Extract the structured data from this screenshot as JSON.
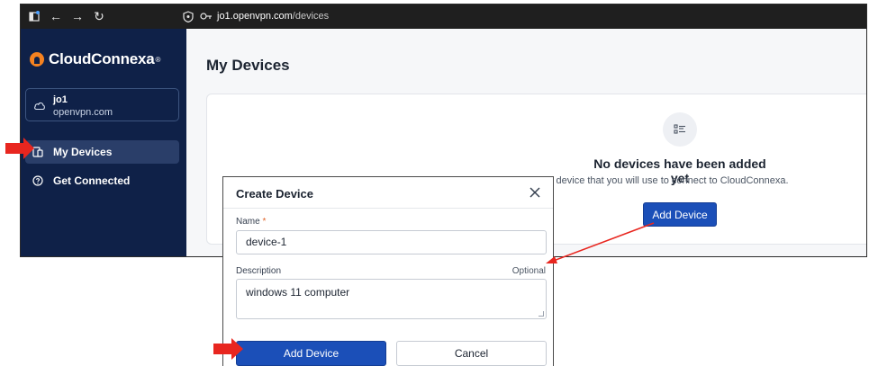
{
  "browser": {
    "url_domain": "jo1.openvpn.com",
    "url_path": "/devices",
    "icons": [
      "tab-icon",
      "back-arrow-icon",
      "forward-arrow-icon",
      "reload-icon",
      "shield-icon",
      "key-icon"
    ]
  },
  "sidebar": {
    "brand": "CloudConnexa",
    "brand_mark": "®",
    "org": {
      "name": "jo1",
      "domain": "openvpn.com"
    },
    "items": [
      {
        "label": "My Devices",
        "icon": "devices-icon",
        "active": true
      },
      {
        "label": "Get Connected",
        "icon": "help-circle-icon",
        "active": false
      }
    ]
  },
  "main": {
    "title": "My Devices",
    "empty_state": {
      "icon": "list-icon",
      "title": "No devices have been added yet",
      "subtitle": "d the device that you will use to connect to CloudConnexa.",
      "button": "Add Device"
    }
  },
  "modal": {
    "title": "Create Device",
    "close_icon": "close-icon",
    "name_label": "Name",
    "required_mark": "*",
    "name_value": "device-1",
    "description_label": "Description",
    "optional_label": "Optional",
    "description_value": "windows 11 computer",
    "submit_label": "Add Device",
    "cancel_label": "Cancel"
  },
  "colors": {
    "sidebar_bg": "#0f2148",
    "primary": "#1b4fb8",
    "annotation": "#e8261f",
    "brand_orange": "#f58220"
  }
}
